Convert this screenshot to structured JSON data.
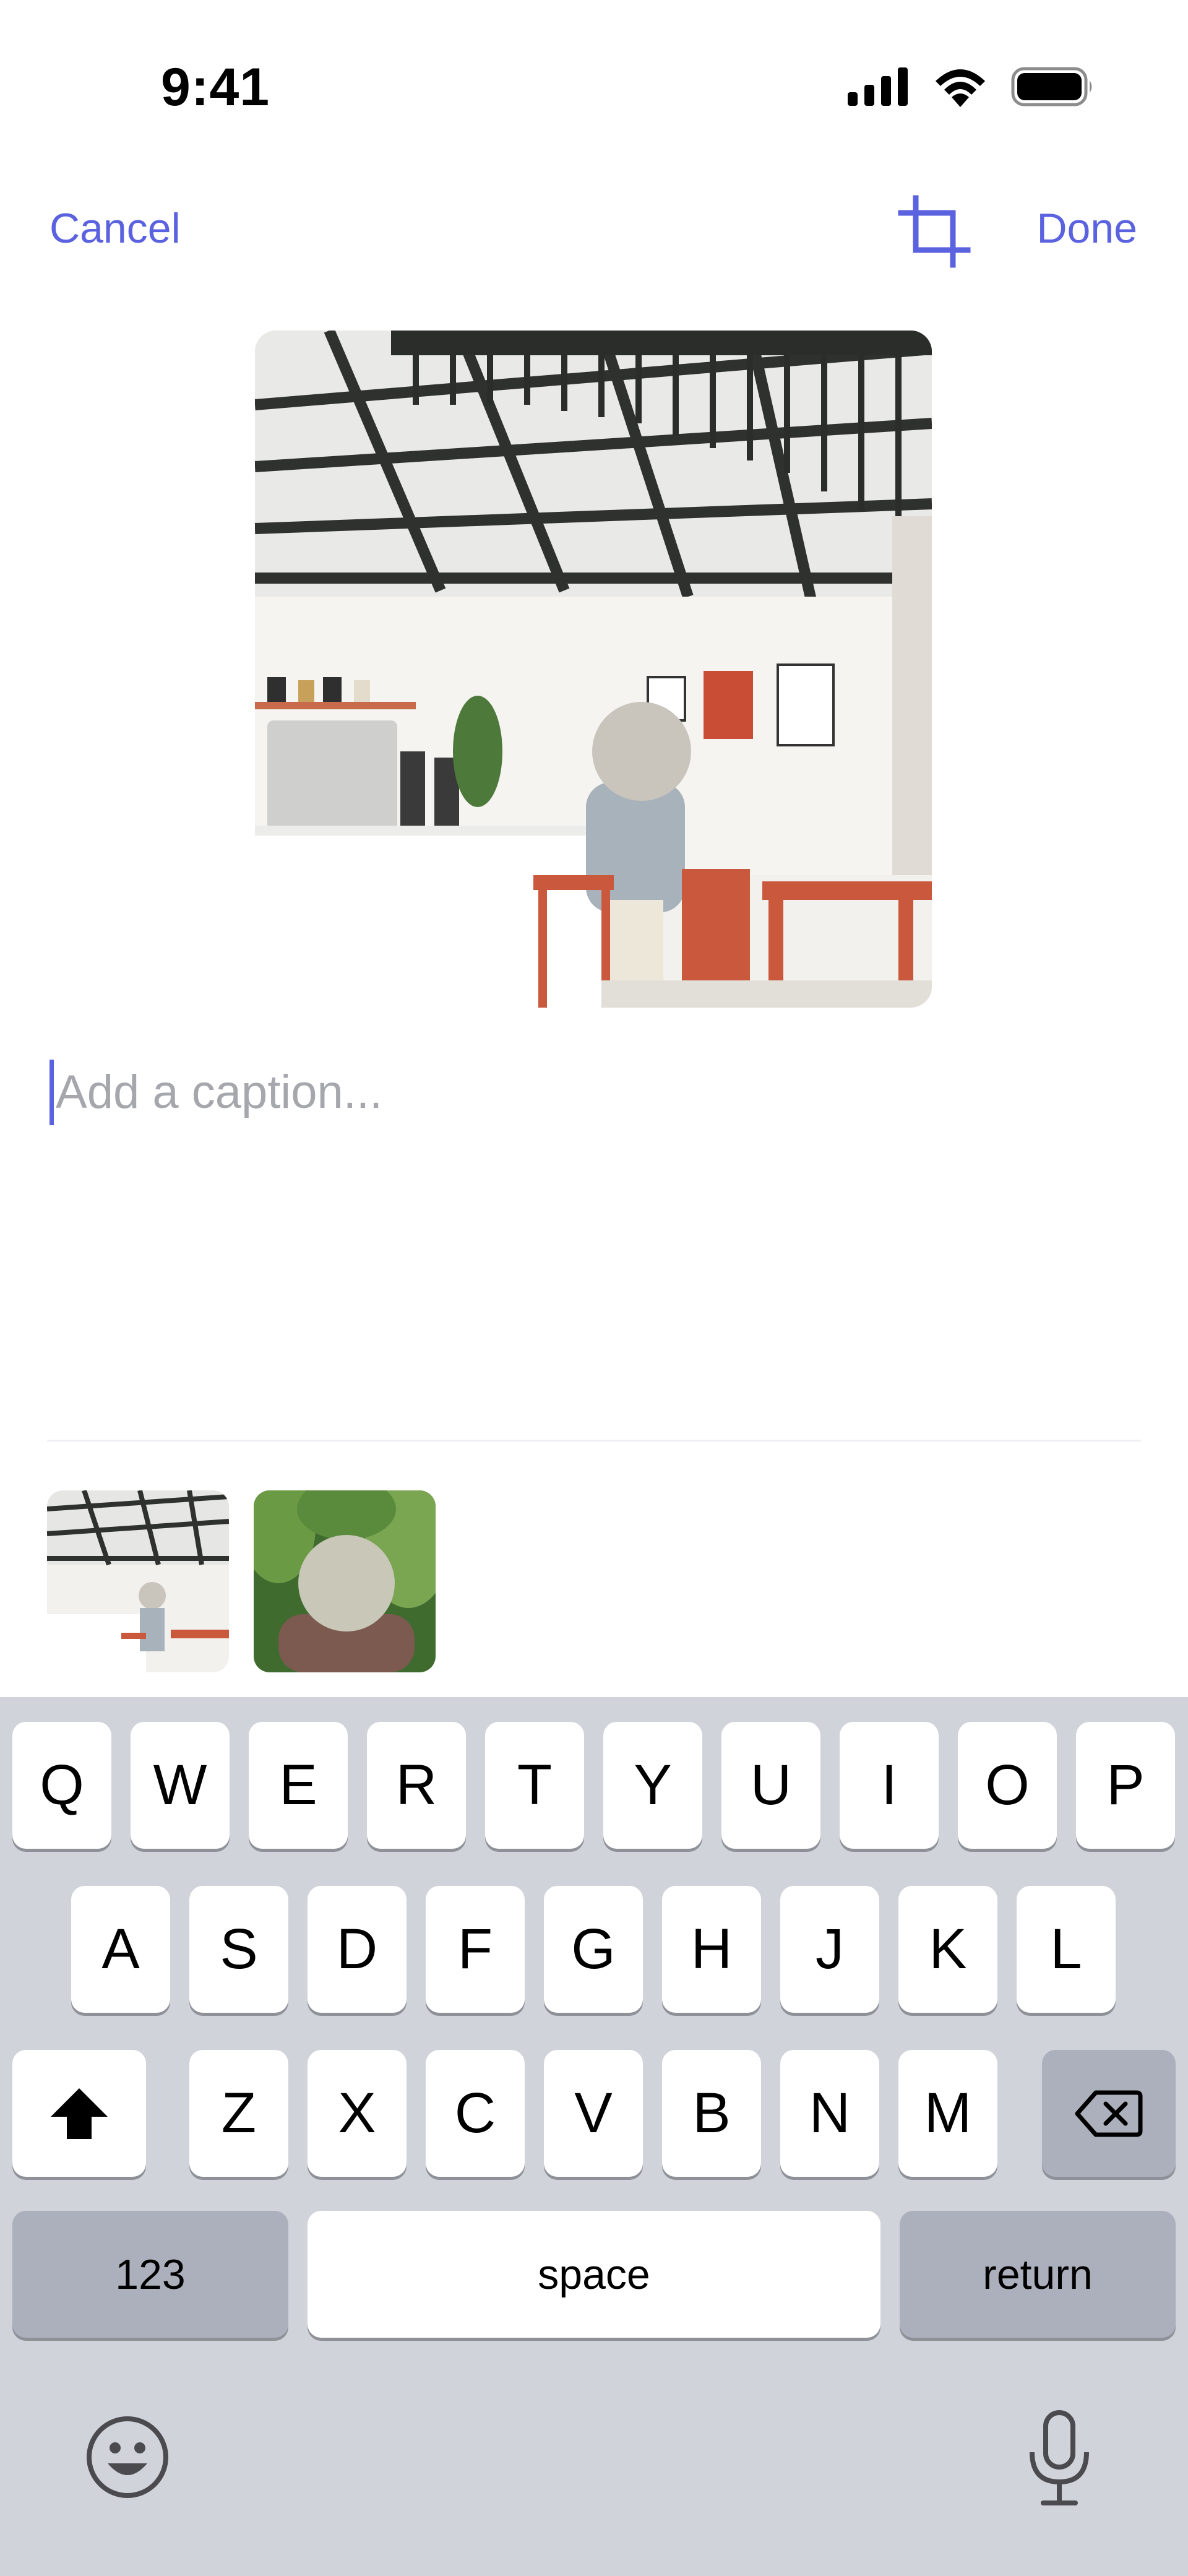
{
  "status_bar": {
    "time": "9:41",
    "icons": [
      "signal-icon",
      "wifi-icon",
      "battery-icon"
    ]
  },
  "nav": {
    "cancel_label": "Cancel",
    "done_label": "Done",
    "crop_icon": "crop-icon"
  },
  "colors": {
    "accent": "#5b62e0",
    "keyboard_bg": "#d1d3da",
    "key_bg": "#ffffff",
    "key_dark_bg": "#abb0bc"
  },
  "caption": {
    "placeholder": "Add a caption..."
  },
  "thumbnails": [
    "cafe-interior-photo",
    "plants-portrait-photo"
  ],
  "keyboard": {
    "row1": [
      "Q",
      "W",
      "E",
      "R",
      "T",
      "Y",
      "U",
      "I",
      "O",
      "P"
    ],
    "row2": [
      "A",
      "S",
      "D",
      "F",
      "G",
      "H",
      "J",
      "K",
      "L"
    ],
    "row3": [
      "Z",
      "X",
      "C",
      "V",
      "B",
      "N",
      "M"
    ],
    "numbers_label": "123",
    "space_label": "space",
    "return_label": "return",
    "icons": [
      "shift-icon",
      "delete-icon",
      "emoji-icon",
      "microphone-icon"
    ]
  }
}
